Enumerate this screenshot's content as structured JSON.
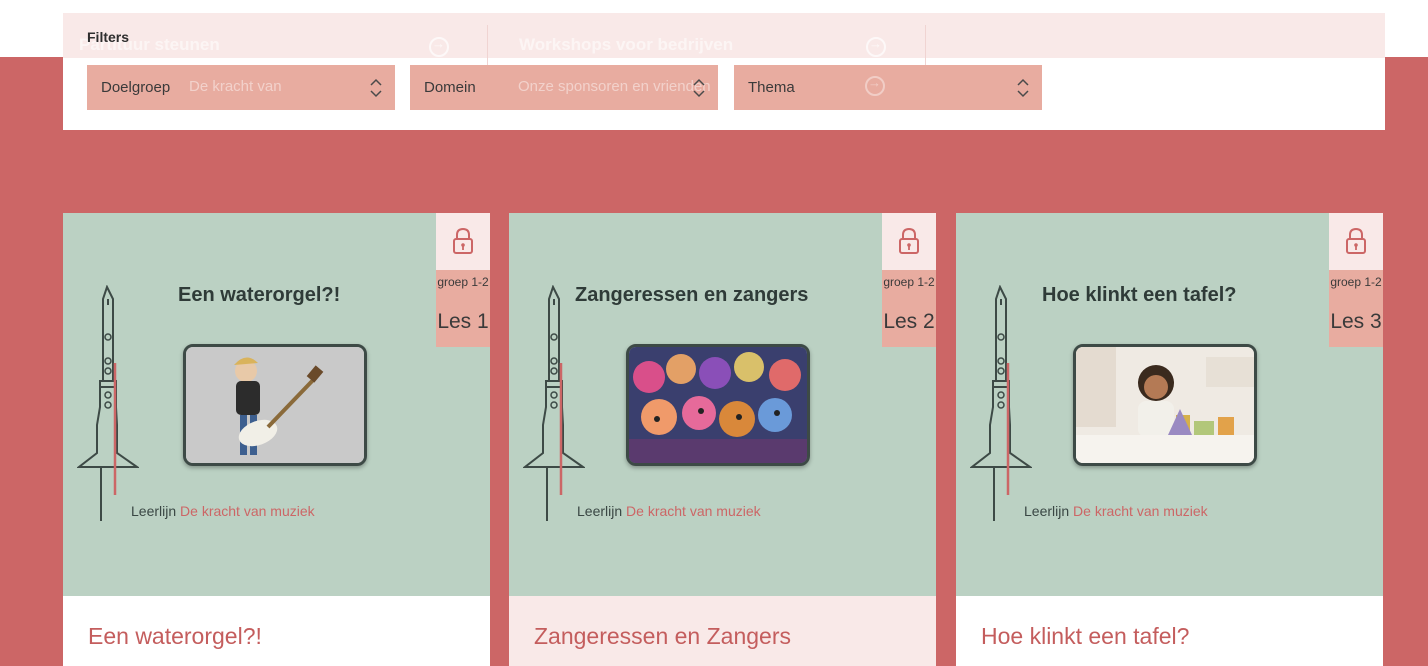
{
  "background_ghost": {
    "item1_title": "Partituur steunen",
    "item1_subtitle": "De kracht van",
    "item2_title": "Workshops voor bedrijven",
    "item2_subtitle": "Onze sponsoren en vrienden"
  },
  "filters": {
    "heading": "Filters",
    "selects": [
      {
        "label": "Doelgroep"
      },
      {
        "label": "Domein"
      },
      {
        "label": "Thema"
      }
    ]
  },
  "cards": [
    {
      "visual_title": "Een waterorgel?!",
      "group": "groep 1-2",
      "lesson": "Les 1",
      "leerlijn_prefix": "Leerlijn",
      "leerlijn_name": "De kracht van muziek",
      "title": "Een waterorgel?!"
    },
    {
      "visual_title": "Zangeressen en zangers",
      "group": "groep 1-2",
      "lesson": "Les 2",
      "leerlijn_prefix": "Leerlijn",
      "leerlijn_name": "De kracht van muziek",
      "title": "Zangeressen en Zangers"
    },
    {
      "visual_title": "Hoe klinkt een tafel?",
      "group": "groep 1-2",
      "lesson": "Les 3",
      "leerlijn_prefix": "Leerlijn",
      "leerlijn_name": "De kracht van muziek",
      "title": "Hoe klinkt een tafel?"
    }
  ],
  "colors": {
    "page_bg": "#cc6666",
    "card_visual_bg": "#bbd1c3",
    "select_bg": "#e8aca0",
    "light_pink": "#f9e9e8",
    "title_color": "#c45d5d"
  },
  "icons": {
    "lock": "lock-icon",
    "chevron": "chevron-up-down-icon",
    "clarinet": "clarinet-illustration"
  }
}
